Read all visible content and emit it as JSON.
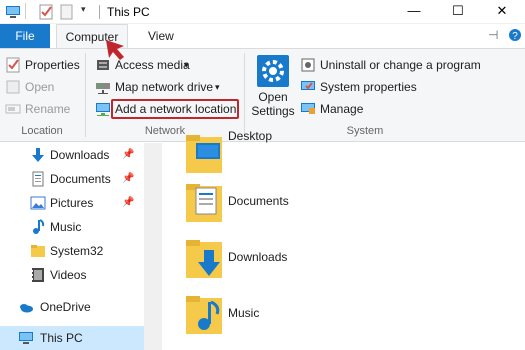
{
  "window": {
    "title": "This PC",
    "controls": {
      "minimize": "—",
      "maximize": "☐",
      "close": "✕"
    }
  },
  "ribbon": {
    "tabs": {
      "file": "File",
      "computer": "Computer",
      "view": "View"
    },
    "location_group": {
      "label": "Location",
      "properties": "Properties",
      "open": "Open",
      "rename": "Rename"
    },
    "network_group": {
      "label": "Network",
      "access_media": "Access media",
      "map_network_drive": "Map network drive",
      "add_network_location": "Add a network location"
    },
    "system_group": {
      "label": "System",
      "open_settings": "Open Settings",
      "open_settings_line1": "Open",
      "open_settings_line2": "Settings",
      "uninstall": "Uninstall or change a program",
      "system_properties": "System properties",
      "manage": "Manage"
    }
  },
  "nav": {
    "items": [
      {
        "label": "Downloads",
        "icon": "download-arrow-icon",
        "pinned": true
      },
      {
        "label": "Documents",
        "icon": "documents-icon",
        "pinned": true
      },
      {
        "label": "Pictures",
        "icon": "pictures-icon",
        "pinned": true
      },
      {
        "label": "Music",
        "icon": "music-note-icon",
        "pinned": false
      },
      {
        "label": "System32",
        "icon": "folder-icon",
        "pinned": false
      },
      {
        "label": "Videos",
        "icon": "videos-icon",
        "pinned": false
      },
      {
        "label": "OneDrive",
        "icon": "cloud-icon",
        "pinned": false
      },
      {
        "label": "This PC",
        "icon": "computer-icon",
        "pinned": false
      }
    ]
  },
  "folders": {
    "items": [
      {
        "label": "Desktop",
        "icon": "desktop-folder-icon"
      },
      {
        "label": "Documents",
        "icon": "documents-folder-icon"
      },
      {
        "label": "Downloads",
        "icon": "downloads-folder-icon"
      },
      {
        "label": "Music",
        "icon": "music-folder-icon"
      }
    ]
  },
  "colors": {
    "accent": "#1979ca",
    "highlight_box": "#c0272d",
    "selected_nav": "#cce8ff",
    "folder": "#f5c94a"
  }
}
